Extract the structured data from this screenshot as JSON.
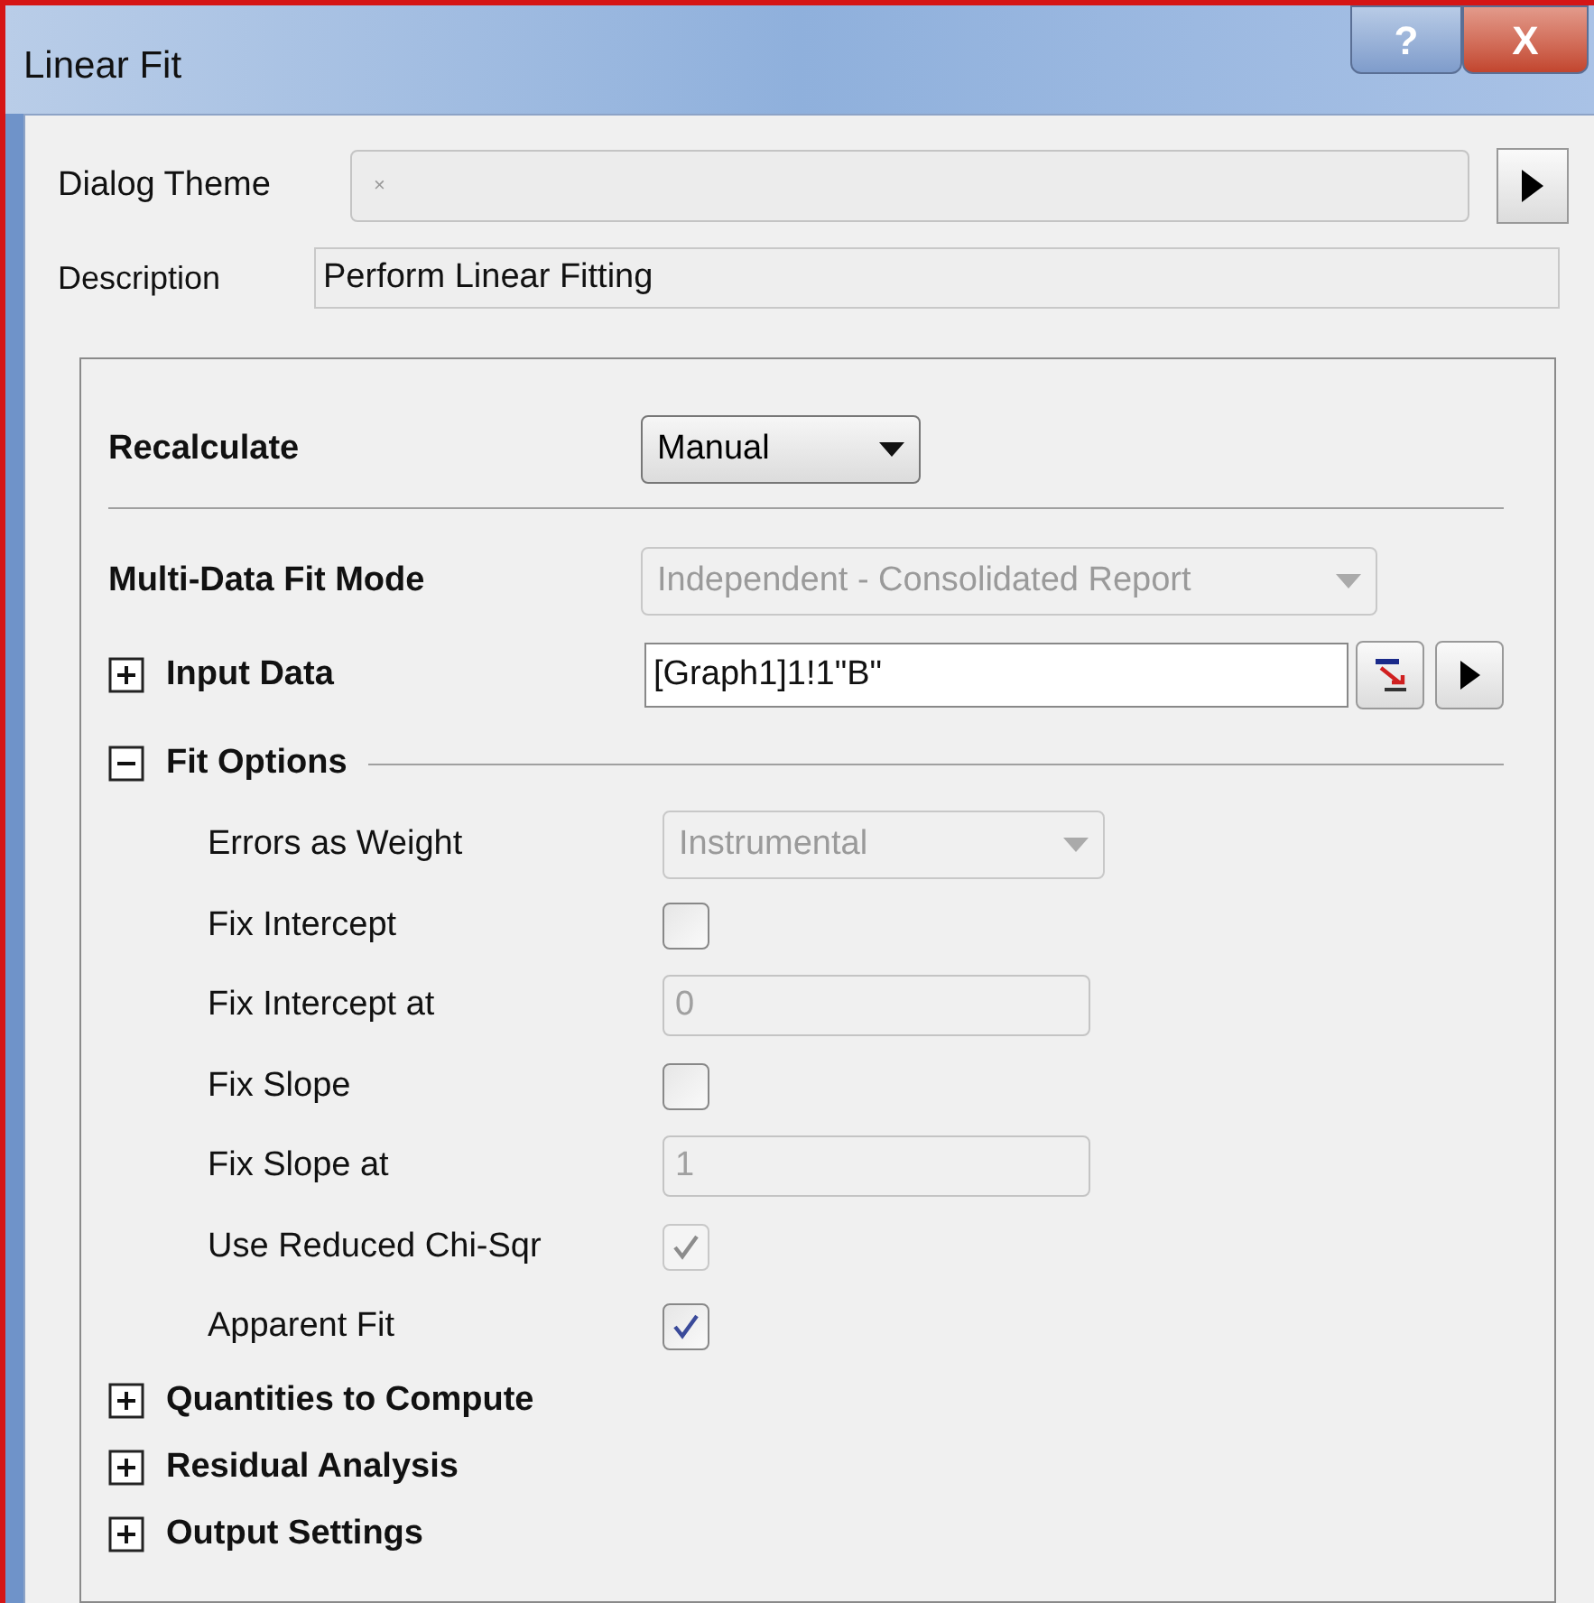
{
  "window": {
    "title": "Linear Fit",
    "buttons": [
      {
        "kind": "help",
        "label": "?"
      },
      {
        "kind": "close",
        "label": "X"
      }
    ]
  },
  "dialog_theme": {
    "label": "Dialog Theme",
    "value": "×"
  },
  "description": {
    "label": "Description",
    "value": "Perform Linear Fitting"
  },
  "recalculate": {
    "label": "Recalculate",
    "value": "Manual",
    "disabled": false
  },
  "multi_data_fit_mode": {
    "label": "Multi-Data Fit Mode",
    "value": "Independent - Consolidated Report",
    "disabled": true
  },
  "input_data": {
    "label": "Input Data",
    "value": "[Graph1]1!1\"B\"",
    "expanded": false
  },
  "fit_options": {
    "label": "Fit Options",
    "expanded": true,
    "items": [
      {
        "kind": "dropdown",
        "label": "Errors as Weight",
        "value": "Instrumental",
        "disabled": true
      },
      {
        "kind": "checkbox",
        "label": "Fix Intercept",
        "checked": false,
        "disabled": false
      },
      {
        "kind": "text",
        "label": "Fix Intercept at",
        "value": "0",
        "disabled": true
      },
      {
        "kind": "checkbox",
        "label": "Fix Slope",
        "checked": false,
        "disabled": false
      },
      {
        "kind": "text",
        "label": "Fix Slope at",
        "value": "1",
        "disabled": true
      },
      {
        "kind": "checkbox",
        "label": "Use Reduced Chi-Sqr",
        "checked": true,
        "disabled": true
      },
      {
        "kind": "checkbox",
        "label": "Apparent Fit",
        "checked": true,
        "disabled": false
      }
    ]
  },
  "sections": [
    {
      "label": "Quantities to Compute",
      "expanded": false
    },
    {
      "label": "Residual Analysis",
      "expanded": false
    },
    {
      "label": "Output Settings",
      "expanded": false
    }
  ]
}
